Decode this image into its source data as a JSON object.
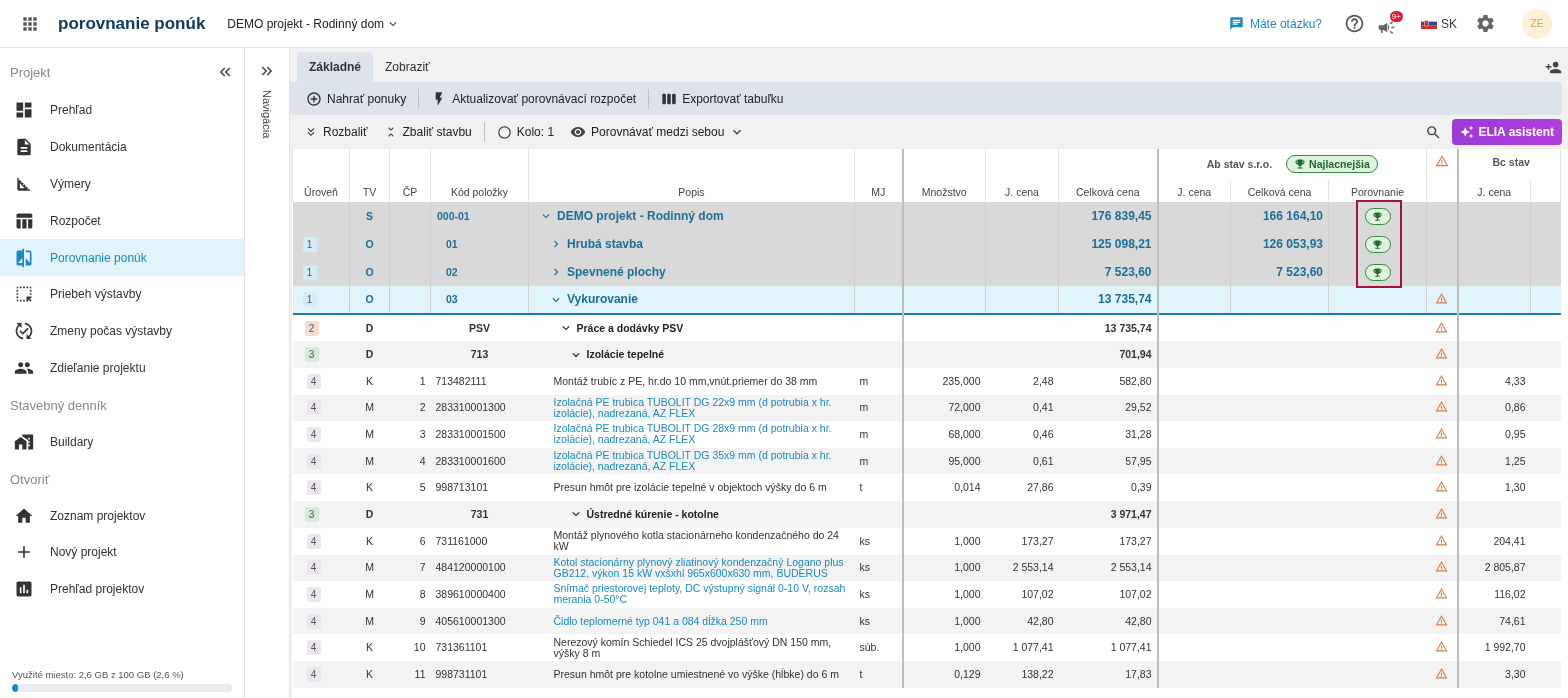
{
  "header": {
    "app_title": "porovnanie ponúk",
    "project": "DEMO projekt - Rodinný dom",
    "help_link": "Máte otázku?",
    "notifications_badge": "9+",
    "language": "SK",
    "avatar": "ZE"
  },
  "sidebar": {
    "title": "Projekt",
    "sections": [
      {
        "items": [
          {
            "label": "Prehľad",
            "selected": false
          },
          {
            "label": "Dokumentácia",
            "selected": false
          },
          {
            "label": "Výmery",
            "selected": false
          },
          {
            "label": "Rozpočet",
            "selected": false
          },
          {
            "label": "Porovnanie ponúk",
            "selected": true
          },
          {
            "label": "Priebeh výstavby",
            "selected": false
          },
          {
            "label": "Zmeny počas výstavby",
            "selected": false
          },
          {
            "label": "Zdieľanie projektu",
            "selected": false
          }
        ]
      },
      {
        "title": "Stavebný denník",
        "items": [
          {
            "label": "Buildary",
            "selected": false
          }
        ]
      },
      {
        "title": "Otvoriť",
        "items": [
          {
            "label": "Zoznam projektov",
            "selected": false
          },
          {
            "label": "Nový projekt",
            "selected": false
          },
          {
            "label": "Prehľad projektov",
            "selected": false
          }
        ]
      }
    ],
    "storage": {
      "text": "Využité miesto: 2,6 GB z 100 GB (2,6 %)",
      "level": 0.026
    }
  },
  "nav_strip": {
    "label": "Navigácia"
  },
  "tabs": [
    {
      "label": "Základné",
      "selected": true
    },
    {
      "label": "Zobraziť",
      "selected": false
    }
  ],
  "toolbar": [
    "Nahrať ponuky",
    "Aktualizovať porovnávací rozpočet",
    "Exportovať tabuľku"
  ],
  "filters": {
    "expand": "Rozbaliť",
    "collapse": "Zbaliť stavbu",
    "round": "Kolo: 1",
    "compare_mode": "Porovnávať medzi sebou",
    "assistant": "ELIA asistent"
  },
  "table": {
    "columns": [
      "Úroveň",
      "TV",
      "ČP",
      "Kód položky",
      "Popis",
      "MJ",
      "Množstvo",
      "J. cena",
      "Celková cena"
    ],
    "suppliers": [
      {
        "name": "Ab stav s.r.o.",
        "badge": "Najlacnejšia",
        "warning": true,
        "columns": [
          "J. cena",
          "Celková cena",
          "Porovnanie"
        ]
      },
      {
        "name": "Bc stav",
        "columns": [
          "J. cena"
        ]
      }
    ],
    "highlight_best": true,
    "rows": [
      {
        "kind": "section",
        "selected": false,
        "tv": "S",
        "code": "000-01",
        "desc": "DEMO projekt - Rodinný dom",
        "expanded": true,
        "total": "176 839,45",
        "offers": [
          {
            "total": "166 164,10",
            "best": true,
            "warning": false
          }
        ],
        "children": [
          {
            "kind": "section",
            "selected": false,
            "uroven": "1",
            "color": "#d4ecf7",
            "tv": "O",
            "code": "01",
            "desc": "Hrubá stavba",
            "expanded": false,
            "total": "125 098,21",
            "offers": [
              {
                "total": "126 053,93",
                "best": true,
                "warning": false
              }
            ]
          },
          {
            "kind": "section",
            "selected": false,
            "uroven": "1",
            "color": "#d4ecf7",
            "tv": "O",
            "code": "02",
            "desc": "Spevnené plochy",
            "expanded": false,
            "total": "7 523,60",
            "offers": [
              {
                "total": "7 523,60",
                "best": true,
                "warning": false
              }
            ]
          },
          {
            "kind": "section",
            "selected": true,
            "uroven": "1",
            "color": "#d4ecf7",
            "tv": "O",
            "code": "03",
            "desc": "Vykurovanie",
            "expanded": true,
            "total": "13 735,74",
            "offers": [
              {
                "best": false,
                "warning": true
              }
            ],
            "children": [
              {
                "kind": "group",
                "selected": false,
                "uroven": "2",
                "color": "#f9ddd3",
                "tv": "D",
                "code": "PSV",
                "desc": "Práce a dodávky PSV",
                "expanded": true,
                "total": "13 735,74",
                "offers": [
                  {
                    "best": false,
                    "warning": true
                  }
                ],
                "children": [
                  {
                    "kind": "group",
                    "selected": false,
                    "uroven": "3",
                    "color": "#d6ecd9",
                    "tv": "D",
                    "code": "713",
                    "desc": "Izolácie tepelné",
                    "expanded": true,
                    "total": "701,94",
                    "offers": [
                      {
                        "best": false,
                        "warning": true
                      }
                    ],
                    "children": [
                      {
                        "kind": "item",
                        "selected": false,
                        "uroven": "4",
                        "color": "#ece6f1",
                        "tv": "K",
                        "cp": "1",
                        "code": "713482111",
                        "desc": "Montáž trubíc z PE, hr.do 10 mm,vnút.priemer do 38 mm",
                        "mj": "m",
                        "qty": "235,000",
                        "price": "2,48",
                        "total": "582,80",
                        "offers": [
                          {
                            "best": false,
                            "warning": true
                          },
                          {
                            "unit_price": "4,33"
                          }
                        ]
                      },
                      {
                        "kind": "material",
                        "selected": false,
                        "uroven": "4",
                        "color": "#ece6f1",
                        "tv": "M",
                        "cp": "2",
                        "code": "283310001300",
                        "desc": "Izolačná PE trubica TUBOLIT DG 22x9 mm (d potrubia x hr. izolácie), nadrezaná, AZ FLEX",
                        "mj": "m",
                        "qty": "72,000",
                        "price": "0,41",
                        "total": "29,52",
                        "offers": [
                          {
                            "best": false,
                            "warning": true
                          },
                          {
                            "unit_price": "0,86"
                          }
                        ]
                      },
                      {
                        "kind": "material",
                        "selected": false,
                        "uroven": "4",
                        "color": "#ece6f1",
                        "tv": "M",
                        "cp": "3",
                        "code": "283310001500",
                        "desc": "Izolačná PE trubica TUBOLIT DG 28x9 mm (d potrubia x hr. izolácie), nadrezaná, AZ FLEX",
                        "mj": "m",
                        "qty": "68,000",
                        "price": "0,46",
                        "total": "31,28",
                        "offers": [
                          {
                            "best": false,
                            "warning": true
                          },
                          {
                            "unit_price": "0,95"
                          }
                        ]
                      },
                      {
                        "kind": "material",
                        "selected": false,
                        "uroven": "4",
                        "color": "#ece6f1",
                        "tv": "M",
                        "cp": "4",
                        "code": "283310001600",
                        "desc": "Izolačná PE trubica TUBOLIT DG 35x9 mm (d potrubia x hr. izolácie), nadrezaná, AZ FLEX",
                        "mj": "m",
                        "qty": "95,000",
                        "price": "0,61",
                        "total": "57,95",
                        "offers": [
                          {
                            "best": false,
                            "warning": true
                          },
                          {
                            "unit_price": "1,25"
                          }
                        ]
                      },
                      {
                        "kind": "item",
                        "selected": false,
                        "uroven": "4",
                        "color": "#ece6f1",
                        "tv": "K",
                        "cp": "5",
                        "code": "998713101",
                        "desc": "Presun hmôt pre izolácie tepelné v objektoch výšky do 6 m",
                        "mj": "t",
                        "qty": "0,014",
                        "price": "27,86",
                        "total": "0,39",
                        "offers": [
                          {
                            "best": false,
                            "warning": true
                          },
                          {
                            "unit_price": "1,30"
                          }
                        ]
                      }
                    ]
                  },
                  {
                    "kind": "group",
                    "selected": false,
                    "uroven": "3",
                    "color": "#d6ecd9",
                    "tv": "D",
                    "code": "731",
                    "desc": "Ústredné kúrenie - kotolne",
                    "expanded": true,
                    "total": "3 971,47",
                    "offers": [
                      {
                        "best": false,
                        "warning": true
                      }
                    ],
                    "children": [
                      {
                        "kind": "item",
                        "selected": false,
                        "uroven": "4",
                        "color": "#ece6f1",
                        "tv": "K",
                        "cp": "6",
                        "code": "731161000",
                        "desc": "Montáž plynového kotla stacionárneho kondenzačného do 24 kW",
                        "mj": "ks",
                        "qty": "1,000",
                        "price": "173,27",
                        "total": "173,27",
                        "offers": [
                          {
                            "best": false,
                            "warning": true
                          },
                          {
                            "unit_price": "204,41"
                          }
                        ]
                      },
                      {
                        "kind": "material",
                        "selected": false,
                        "uroven": "4",
                        "color": "#ece6f1",
                        "tv": "M",
                        "cp": "7",
                        "code": "484120000100",
                        "desc": "Kotol stacionárny plynový zliatinový kondenzačný Logano plus GB212, výkon 15 kW vxšxhl 965x600x630 mm, BUDERUS",
                        "mj": "ks",
                        "qty": "1,000",
                        "price": "2 553,14",
                        "total": "2 553,14",
                        "offers": [
                          {
                            "best": false,
                            "warning": true
                          },
                          {
                            "unit_price": "2 805,87"
                          }
                        ]
                      },
                      {
                        "kind": "material",
                        "selected": false,
                        "uroven": "4",
                        "color": "#ece6f1",
                        "tv": "M",
                        "cp": "8",
                        "code": "389610000400",
                        "desc": "Snímač priestorovej teploty, DC výstupný signál 0-10 V, rozsah merania 0-50°C",
                        "mj": "ks",
                        "qty": "1,000",
                        "price": "107,02",
                        "total": "107,02",
                        "offers": [
                          {
                            "best": false,
                            "warning": true
                          },
                          {
                            "unit_price": "116,02"
                          }
                        ]
                      },
                      {
                        "kind": "material",
                        "selected": false,
                        "uroven": "4",
                        "color": "#ece6f1",
                        "tv": "M",
                        "cp": "9",
                        "code": "405610001300",
                        "desc": "Čidlo teplomerné typ 041 a 084 dĺžka 250 mm",
                        "mj": "ks",
                        "qty": "1,000",
                        "price": "42,80",
                        "total": "42,80",
                        "offers": [
                          {
                            "best": false,
                            "warning": true
                          },
                          {
                            "unit_price": "74,61"
                          }
                        ]
                      },
                      {
                        "kind": "item",
                        "selected": false,
                        "uroven": "4",
                        "color": "#ece6f1",
                        "tv": "K",
                        "cp": "10",
                        "code": "731361101",
                        "desc": "Nerezový komín Schiedel ICS 25 dvojplášťový DN 150 mm, výšky 8 m",
                        "mj": "súb.",
                        "qty": "1,000",
                        "price": "1 077,41",
                        "total": "1 077,41",
                        "offers": [
                          {
                            "best": false,
                            "warning": true
                          },
                          {
                            "unit_price": "1 992,70"
                          }
                        ]
                      },
                      {
                        "kind": "item",
                        "selected": false,
                        "uroven": "4",
                        "color": "#ece6f1",
                        "tv": "K",
                        "cp": "11",
                        "code": "998731101",
                        "desc": "Presun hmôt pre kotolne umiestnené vo výške (hĺbke) do 6 m",
                        "mj": "t",
                        "qty": "0,129",
                        "price": "138,22",
                        "total": "17,83",
                        "offers": [
                          {
                            "best": false,
                            "warning": true
                          },
                          {
                            "unit_price": "3,30"
                          }
                        ]
                      }
                    ]
                  }
                ]
              }
            ]
          }
        ]
      }
    ]
  }
}
